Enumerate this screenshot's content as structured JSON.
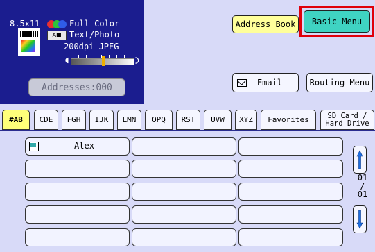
{
  "status": {
    "paper_size": "8.5x11",
    "color_mode": "Full Color",
    "quality": "Text/Photo",
    "resolution": "200dpi JPEG",
    "addresses_label": "Addresses:000",
    "color_dots": [
      "#e83030",
      "#2ec53a",
      "#2f5ce8"
    ],
    "density_level": 0.5
  },
  "top_buttons": {
    "address_book": "Address Book",
    "basic_menu": "Basic Menu",
    "email": "Email",
    "routing_menu": "Routing Menu"
  },
  "tabs": [
    {
      "label": "#AB",
      "active": true
    },
    {
      "label": "CDE"
    },
    {
      "label": "FGH"
    },
    {
      "label": "IJK"
    },
    {
      "label": "LMN"
    },
    {
      "label": "OPQ"
    },
    {
      "label": "RST"
    },
    {
      "label": "UVW"
    },
    {
      "label": "XYZ"
    },
    {
      "label": "Favorites"
    },
    {
      "label": "SD Card / Hard Drive"
    }
  ],
  "address_grid": {
    "rows": [
      [
        "Alex",
        "",
        ""
      ],
      [
        "",
        "",
        ""
      ],
      [
        "",
        "",
        ""
      ],
      [
        "",
        "",
        ""
      ],
      [
        "",
        "",
        ""
      ]
    ]
  },
  "pagination": {
    "current": "01",
    "separator": "/",
    "total": "01"
  },
  "colors": {
    "background": "#d8daf8",
    "status_panel": "#1b1d8f",
    "address_book_button": "#ffff9a",
    "basic_menu_button": "#3fd3c2",
    "highlight_outline": "#e0000a",
    "active_tab": "#ffff7a",
    "scroll_arrow": "#1e6fe0"
  }
}
